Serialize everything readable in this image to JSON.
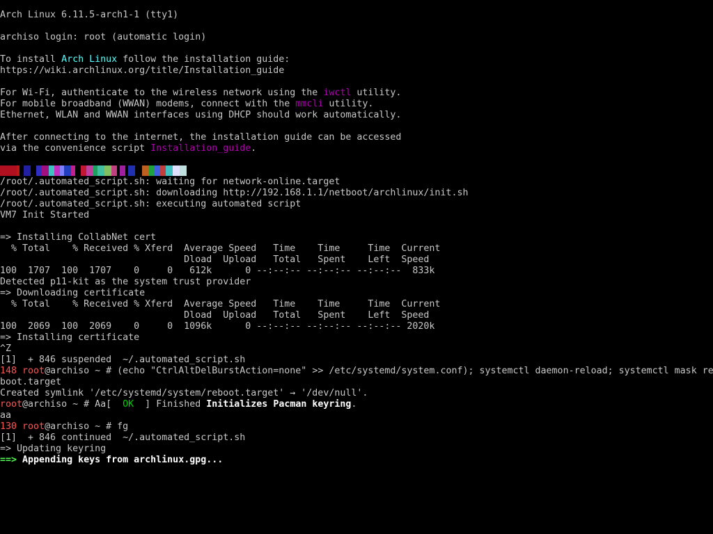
{
  "terminal": {
    "tty": "tty1",
    "prompt_user": "root",
    "prompt_host": "@archiso",
    "lines": [
      [
        {
          "t": "Arch Linux 6.11.5-arch1-1 (tty1)",
          "c": "white"
        }
      ],
      [],
      [
        {
          "t": "archiso login: root (automatic login)",
          "c": "white"
        }
      ],
      [],
      [
        {
          "t": "To install ",
          "c": "white"
        },
        {
          "t": "Arch Linux",
          "c": "cyan"
        },
        {
          "t": " follow the installation guide:",
          "c": "white"
        }
      ],
      [
        {
          "t": "https://wiki.archlinux.org/title/Installation_guide",
          "c": "white"
        }
      ],
      [],
      [
        {
          "t": "For Wi-Fi, authenticate to the wireless network using the ",
          "c": "white"
        },
        {
          "t": "iwctl",
          "c": "magenta"
        },
        {
          "t": " utility.",
          "c": "white"
        }
      ],
      [
        {
          "t": "For mobile broadband (WWAN) modems, connect with the ",
          "c": "white"
        },
        {
          "t": "mmcli",
          "c": "magenta"
        },
        {
          "t": " utility.",
          "c": "white"
        }
      ],
      [
        {
          "t": "Ethernet, WLAN and WWAN interfaces using DHCP should work automatically.",
          "c": "white"
        }
      ],
      [],
      [
        {
          "t": "After connecting to the internet, the installation guide can be accessed",
          "c": "white"
        }
      ],
      [
        {
          "t": "via the convenience script ",
          "c": "white"
        },
        {
          "t": "Installation_guide",
          "c": "magenta"
        },
        {
          "t": ".",
          "c": "white"
        }
      ],
      [],
      "NOISE",
      [
        {
          "t": "/root/.automated_script.sh: waiting for network-online.target",
          "c": "white"
        }
      ],
      [
        {
          "t": "/root/.automated_script.sh: downloading http://192.168.1.1/netboot/archlinux/init.sh",
          "c": "white"
        }
      ],
      [
        {
          "t": "/root/.automated_script.sh: executing automated script",
          "c": "white"
        }
      ],
      [
        {
          "t": "VM7 Init Started",
          "c": "white"
        }
      ],
      [],
      [
        {
          "t": "=> Installing CollabNet cert",
          "c": "white"
        }
      ],
      [
        {
          "t": "  % Total    % Received % Xferd  Average Speed   Time    Time     Time  Current",
          "c": "white"
        }
      ],
      [
        {
          "t": "                                 Dload  Upload   Total   Spent    Left  Speed",
          "c": "white"
        }
      ],
      [
        {
          "t": "100  1707  100  1707    0     0   612k      0 --:--:-- --:--:-- --:--:--  833k",
          "c": "white"
        }
      ],
      [
        {
          "t": "Detected p11-kit as the system trust provider",
          "c": "white"
        }
      ],
      [
        {
          "t": "=> Downloading certificate",
          "c": "white"
        }
      ],
      [
        {
          "t": "  % Total    % Received % Xferd  Average Speed   Time    Time     Time  Current",
          "c": "white"
        }
      ],
      [
        {
          "t": "                                 Dload  Upload   Total   Spent    Left  Speed",
          "c": "white"
        }
      ],
      [
        {
          "t": "100  2069  100  2069    0     0  1096k      0 --:--:-- --:--:-- --:--:-- 2020k",
          "c": "white"
        }
      ],
      [
        {
          "t": "=> Installing certificate",
          "c": "white"
        }
      ],
      [
        {
          "t": "^Z",
          "c": "white"
        }
      ],
      [
        {
          "t": "[1]  + 846 suspended  ~/.automated_script.sh",
          "c": "white"
        }
      ],
      [
        {
          "t": "148 ",
          "c": "red"
        },
        {
          "t": "root",
          "c": "red"
        },
        {
          "t": "@archiso ~ # (echo \"CtrlAltDelBurstAction=none\" >> /etc/systemd/system.conf); systemctl daemon-reload; systemctl mask re",
          "c": "white"
        }
      ],
      [
        {
          "t": "boot.target",
          "c": "white"
        }
      ],
      [
        {
          "t": "Created symlink '/etc/systemd/system/reboot.target' → '/dev/null'.",
          "c": "white"
        }
      ],
      [
        {
          "t": "root",
          "c": "red"
        },
        {
          "t": "@archiso ~ # Aa[  ",
          "c": "white"
        },
        {
          "t": "OK",
          "c": "green"
        },
        {
          "t": "  ] ",
          "c": "white"
        },
        {
          "t": "Finished ",
          "c": "white"
        },
        {
          "t": "Initializes Pacman keyring",
          "c": "bright"
        },
        {
          "t": ".",
          "c": "white"
        }
      ],
      [
        {
          "t": "aa",
          "c": "white"
        }
      ],
      [
        {
          "t": "130 ",
          "c": "red"
        },
        {
          "t": "root",
          "c": "red"
        },
        {
          "t": "@archiso ~ # fg",
          "c": "white"
        }
      ],
      [
        {
          "t": "[1]  + 846 continued  ~/.automated_script.sh",
          "c": "white"
        }
      ],
      [
        {
          "t": "=> Updating keyring",
          "c": "white"
        }
      ],
      [
        {
          "t": "==>",
          "c": "bgreen"
        },
        {
          "t": " Appending keys from archlinux.gpg...",
          "c": "bright"
        }
      ]
    ]
  },
  "noise_colors": [
    "#b01020",
    "#c01818",
    "#000000",
    "#2020a0",
    "#000000",
    "#3030c0",
    "#a01080",
    "#40c0c0",
    "#c030c0",
    "#8080ff",
    "#2040c0",
    "#c02090",
    "#000000",
    "#c01830",
    "#c040a0",
    "#20a060",
    "#40c0a0",
    "#80c060",
    "#c04080",
    "#000000",
    "#a020a0",
    "#000000",
    "#2030b0",
    "#000000",
    "#c06020",
    "#20a040",
    "#4060e0",
    "#c04040",
    "#40c0c0",
    "#e0e0ff",
    "#c0e0e0"
  ]
}
